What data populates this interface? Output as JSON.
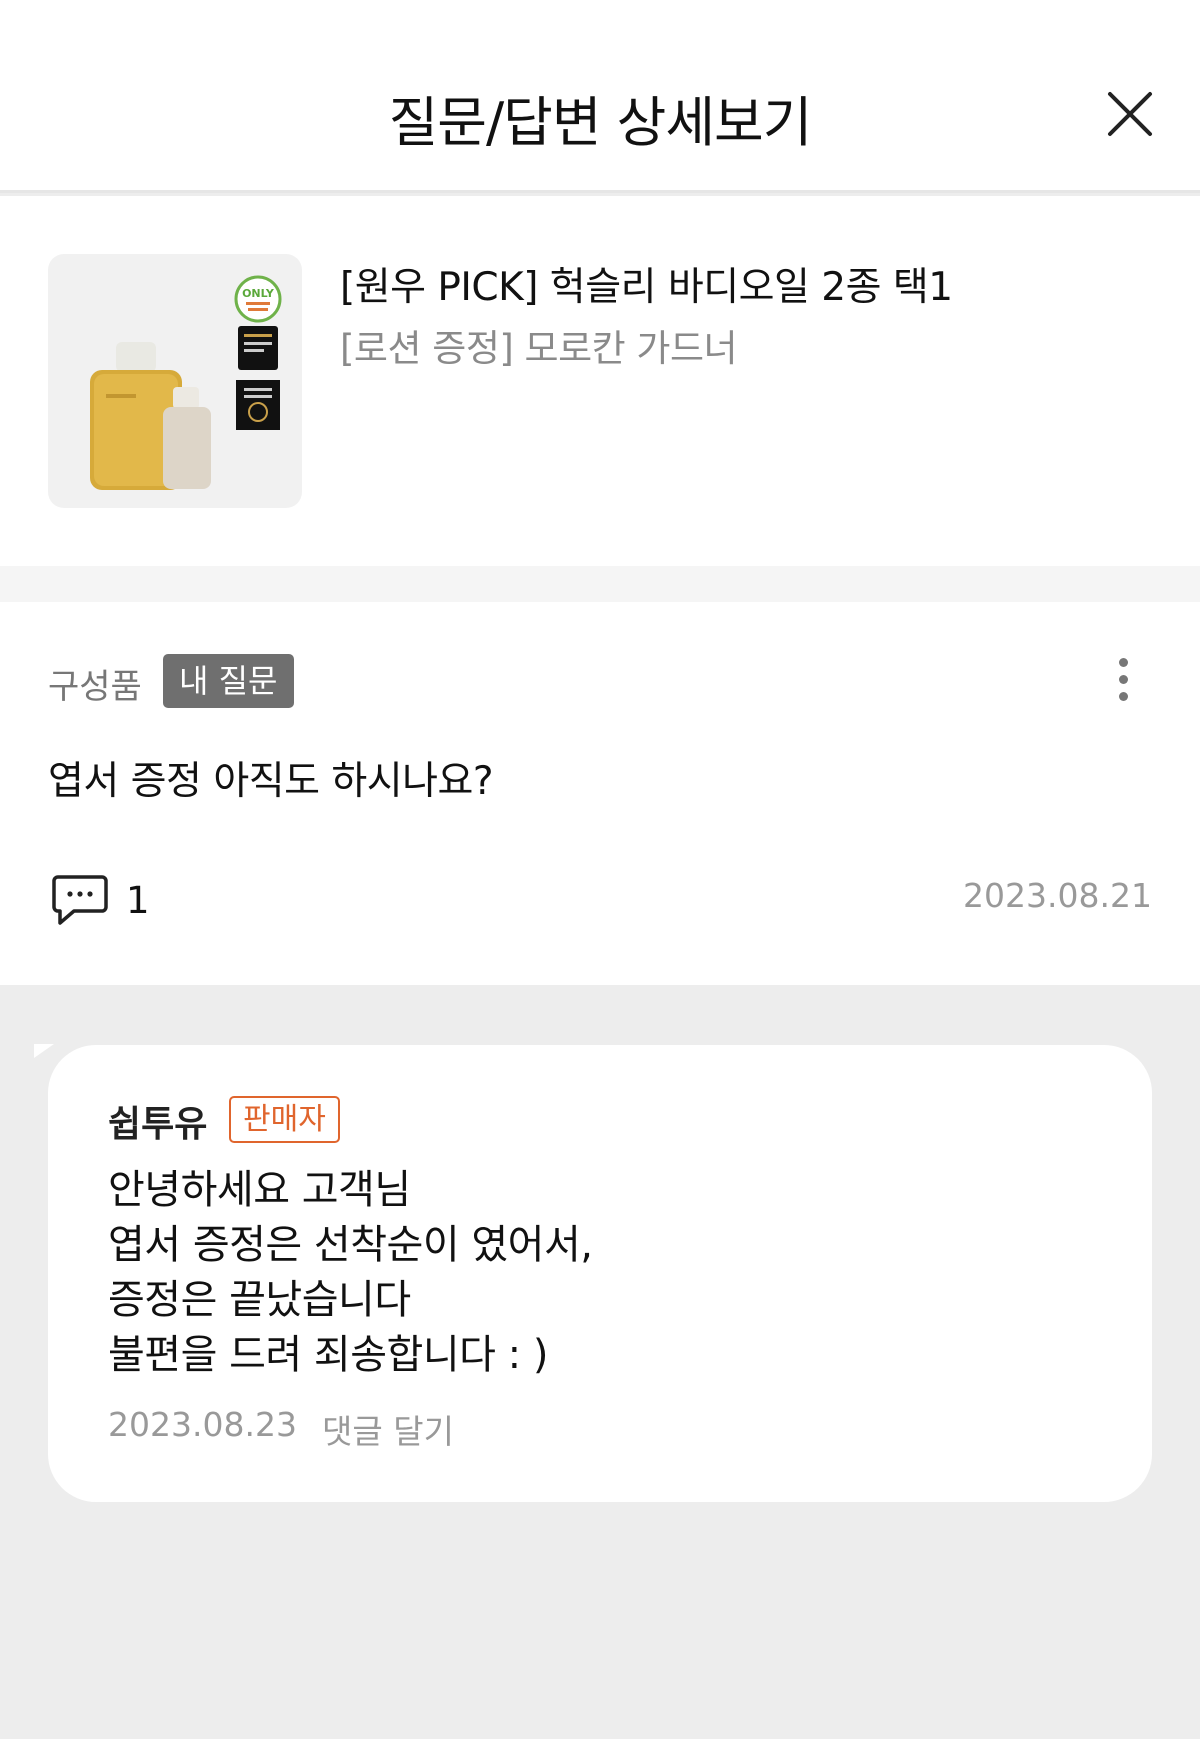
{
  "header": {
    "title": "질문/답변 상세보기",
    "close_icon": "close-icon"
  },
  "product": {
    "name": "[원우 PICK] 헉슬리 바디오일 2종 택1",
    "option": "[로션 증정] 모로칸 가드너",
    "thumbnail_badge_text": "ONLY"
  },
  "question": {
    "category": "구성품",
    "badge": "내 질문",
    "text": "엽서 증정 아직도 하시나요?",
    "comment_count": "1",
    "date": "2023.08.21",
    "more_icon": "more-vertical-icon",
    "comment_icon": "comment-icon"
  },
  "answer": {
    "author": "쉽투유",
    "author_badge": "판매자",
    "text": "안녕하세요 고객님\n엽서 증정은 선착순이 였어서,\n증정은 끝났습니다\n불편을 드려 죄송합니다 : )",
    "date": "2023.08.23",
    "reply_label": "댓글 달기"
  },
  "colors": {
    "background": "#ededed",
    "badge_gray": "#6f6f6f",
    "seller_orange": "#e0652d",
    "muted_text": "#999999"
  }
}
